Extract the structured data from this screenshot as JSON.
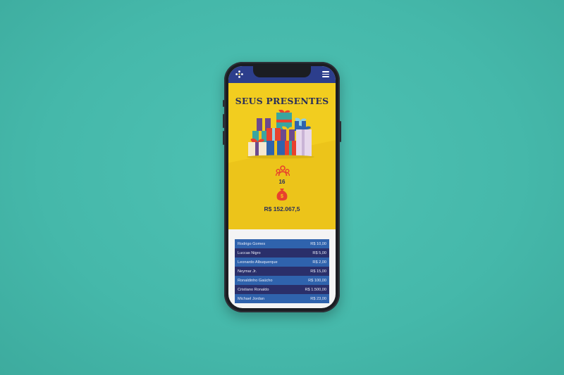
{
  "page": {
    "title": "SEUS PRESENTES",
    "guest_count": "16",
    "total_amount": "R$ 152.067,5"
  },
  "gifts": [
    {
      "name": "Rodrigo Gomes",
      "amount": "R$ 10,00"
    },
    {
      "name": "Luccas Nigro",
      "amount": "R$ 5,00"
    },
    {
      "name": "Leonardo Albuquerque",
      "amount": "R$ 2,00"
    },
    {
      "name": "Neymar Jr.",
      "amount": "R$ 15,00"
    },
    {
      "name": "Ronaldinho Gaúcho",
      "amount": "R$ 100,00"
    },
    {
      "name": "Cristiano Ronaldo",
      "amount": "R$ 1.500,00"
    },
    {
      "name": "Michael Jordan",
      "amount": "R$ 23,00"
    }
  ],
  "icons": {
    "app_logo": "app-logo-icon",
    "menu": "hamburger-menu-icon",
    "guests": "people-icon",
    "money": "money-bag-icon",
    "illustration": "gift-boxes-illustration"
  },
  "colors": {
    "background": "#45b8aa",
    "header": "#2c3e8c",
    "hero": "#f2cd1f",
    "accent_red": "#e8412e",
    "row_light": "#2f63ad",
    "row_dark": "#2a2f6a"
  }
}
